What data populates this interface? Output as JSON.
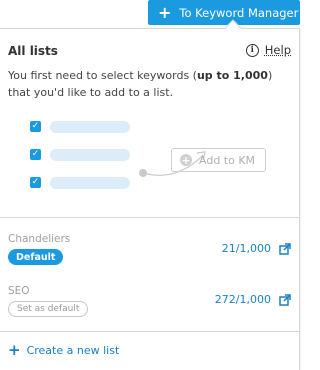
{
  "header": {
    "button_label": "To Keyword Manager",
    "button_icon": "plus-icon"
  },
  "panel": {
    "title": "All lists",
    "help_label": "Help",
    "help_icon": "info-icon",
    "description_pre": "You first need to select keywords (",
    "description_bold": "up to 1,000",
    "description_post": ") that you'd like to add to a list.",
    "illustration": {
      "add_button_label": "Add to KM",
      "checkbox_count": 3
    }
  },
  "lists": [
    {
      "name": "Chandeliers",
      "badge": "Default",
      "is_default": true,
      "count": "21/1,000"
    },
    {
      "name": "SEO",
      "badge": "Set as default",
      "is_default": false,
      "count": "272/1,000"
    }
  ],
  "footer": {
    "create_label": "Create a new list"
  },
  "colors": {
    "accent": "#1b9ae0",
    "link": "#1b7fc4",
    "muted": "#a0a0a0"
  }
}
